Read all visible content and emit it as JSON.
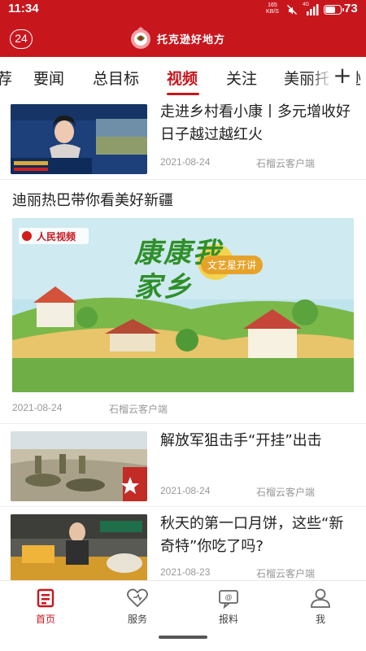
{
  "status_bar": {
    "time": "11:34",
    "net_speed": "165",
    "net_unit": "KB/S",
    "signal_label": "4G",
    "battery_level": 0.73,
    "battery_pct": "73"
  },
  "header": {
    "badge": "24",
    "logo_text": "托克逊好地方",
    "colors": {
      "brand": "#c8161d",
      "brand_accent": "#f2a0a6"
    }
  },
  "tabs": {
    "items": [
      {
        "label": "荐"
      },
      {
        "label": "要闻"
      },
      {
        "label": "总目标"
      },
      {
        "label": "视频"
      },
      {
        "label": "关注"
      },
      {
        "label": "美丽托克逊"
      }
    ],
    "active": "视频",
    "more_icon": "plus-icon"
  },
  "news": [
    {
      "title": "走进乡村看小康丨多元增收好日子越过越红火",
      "date": "2021-08-24",
      "source": "石榴云客户端"
    },
    {
      "title": "迪丽热巴带你看美好新疆",
      "date": "2021-08-24",
      "source": "石榴云客户端",
      "image_caption": "康康我家乡",
      "image_badge": "文艺星开讲",
      "image_logo": "人民视频"
    },
    {
      "title": "解放军狙击手“开挂”出击",
      "date": "2021-08-24",
      "source": "石榴云客户端"
    },
    {
      "title": "秋天的第一口月饼，这些“新奇特”你吃了吗?",
      "date": "2021-08-23",
      "source": "石榴云客户端"
    }
  ],
  "bottom_nav": {
    "items": [
      {
        "label": "首页",
        "icon": "home-icon",
        "active": true
      },
      {
        "label": "服务",
        "icon": "heart-icon",
        "active": false
      },
      {
        "label": "报料",
        "icon": "report-icon",
        "active": false
      },
      {
        "label": "我",
        "icon": "user-icon",
        "active": false
      }
    ]
  }
}
